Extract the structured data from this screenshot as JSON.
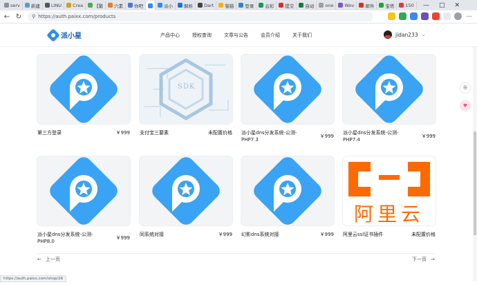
{
  "browser": {
    "tabs": [
      {
        "label": "serv",
        "color": "#8a8f99"
      },
      {
        "label": "新建",
        "color": "#5b9bd5"
      },
      {
        "label": "LINU",
        "color": "#555555"
      },
      {
        "label": "Crea",
        "color": "#d4a017"
      },
      {
        "label": "【繁",
        "color": "#4caf50"
      },
      {
        "label": "六素",
        "color": "#e67e22"
      },
      {
        "label": "你吧",
        "color": "#3d7be0"
      },
      {
        "label": "",
        "color": "#2f8cf0",
        "active": true
      },
      {
        "label": "派小",
        "color": "#2f8cf0"
      },
      {
        "label": "解析",
        "color": "#1a73e8"
      },
      {
        "label": "Dart",
        "color": "#444444"
      },
      {
        "label": "猫猫",
        "color": "#f4b400"
      },
      {
        "label": "登录",
        "color": "#1e88e5"
      },
      {
        "label": "云彩",
        "color": "#0f9d58"
      },
      {
        "label": "提交",
        "color": "#d93025"
      },
      {
        "label": "自动",
        "color": "#0b8043"
      },
      {
        "label": "one",
        "color": "#9e9e9e"
      },
      {
        "label": "Wov",
        "color": "#7e57c2"
      },
      {
        "label": "邮件",
        "color": "#d93025"
      },
      {
        "label": "宝塔",
        "color": "#20a53a"
      },
      {
        "label": "150",
        "color": "#e53935"
      }
    ],
    "url": "https://auth.paixx.com/products",
    "window_controls": [
      "—",
      "□",
      "✕"
    ]
  },
  "header": {
    "logo_text": "派小星",
    "nav": [
      "产品中心",
      "授权查询",
      "文章与公告",
      "会员介绍",
      "关于我们"
    ],
    "username": "jidan233"
  },
  "products": [
    {
      "title": "第三方登录",
      "price": "￥999",
      "image": "paixiaoxing-logo"
    },
    {
      "title": "支付宝三要素",
      "price": "未配置价格",
      "image": "sdk-hexagon",
      "sdk_text": "SDK"
    },
    {
      "title": "派小星dns分发系统-公测-PHP7.3",
      "price": "￥999",
      "image": "paixiaoxing-logo"
    },
    {
      "title": "派小星dns分发系统-公测-PHP7.4",
      "price": "￥999",
      "image": "paixiaoxing-logo"
    },
    {
      "title": "派小星dns分发系统-公测-PHP8.0",
      "price": "￥999",
      "image": "paixiaoxing-logo"
    },
    {
      "title": "同系统对接",
      "price": "￥999",
      "image": "paixiaoxing-logo"
    },
    {
      "title": "幻影dns系统对接",
      "price": "￥999",
      "image": "paixiaoxing-logo"
    },
    {
      "title": "阿里云ssl证书插件",
      "price": "未配置价格",
      "image": "aliyun-logo",
      "aliyun_text": "阿里云"
    }
  ],
  "pager": {
    "prev": "上一页",
    "next": "下一页"
  },
  "status_url": "https://auth.paixx.com/shop/26",
  "colors": {
    "brand_blue": "#3aa3f4",
    "aliyun_orange": "#ff6a00"
  }
}
